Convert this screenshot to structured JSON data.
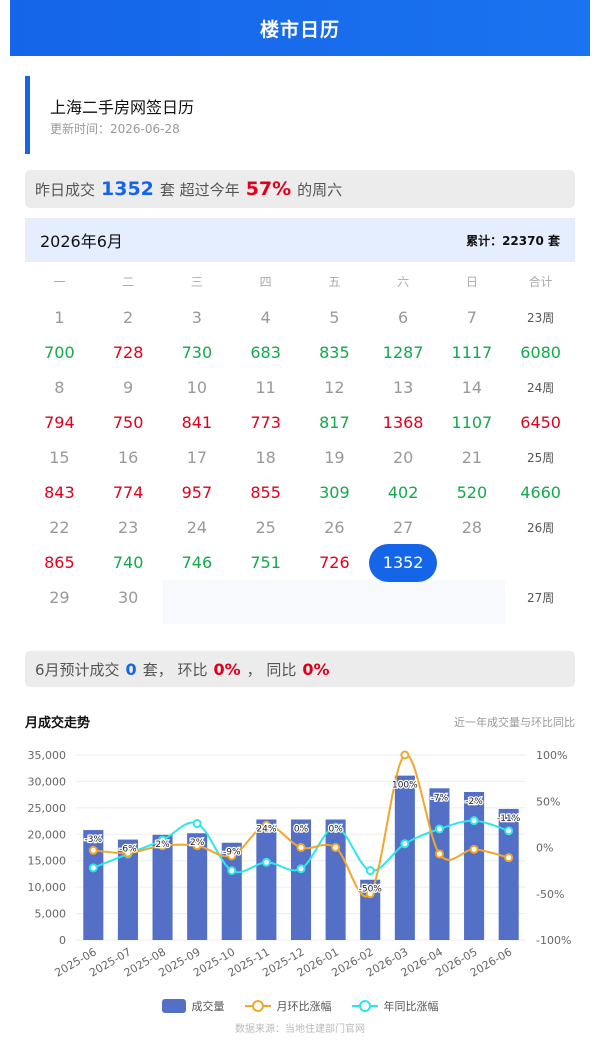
{
  "app": {
    "title": "楼市日历"
  },
  "header": {
    "title": "上海二手房网签日历",
    "updated": "更新时间：2026-06-28"
  },
  "banner": {
    "prefix": "昨日成交",
    "count": "1352",
    "unit": "套 超过今年",
    "pct": "57%",
    "suffix": "的周六"
  },
  "calendar": {
    "month": "2026年6月",
    "total": "累计：22370 套",
    "weekdays": [
      "一",
      "二",
      "三",
      "四",
      "五",
      "六",
      "日",
      "合计"
    ],
    "weeks": [
      {
        "days": [
          "1",
          "2",
          "3",
          "4",
          "5",
          "6",
          "7"
        ],
        "label": "23周",
        "values": [
          [
            "700",
            "down"
          ],
          [
            "728",
            "up"
          ],
          [
            "730",
            "down"
          ],
          [
            "683",
            "down"
          ],
          [
            "835",
            "down"
          ],
          [
            "1287",
            "down"
          ],
          [
            "1117",
            "down"
          ]
        ],
        "sum": [
          "6080",
          "down"
        ]
      },
      {
        "days": [
          "8",
          "9",
          "10",
          "11",
          "12",
          "13",
          "14"
        ],
        "label": "24周",
        "values": [
          [
            "794",
            "up"
          ],
          [
            "750",
            "up"
          ],
          [
            "841",
            "up"
          ],
          [
            "773",
            "up"
          ],
          [
            "817",
            "down"
          ],
          [
            "1368",
            "up"
          ],
          [
            "1107",
            "down"
          ]
        ],
        "sum": [
          "6450",
          "up"
        ]
      },
      {
        "days": [
          "15",
          "16",
          "17",
          "18",
          "19",
          "20",
          "21"
        ],
        "label": "25周",
        "values": [
          [
            "843",
            "up"
          ],
          [
            "774",
            "up"
          ],
          [
            "957",
            "up"
          ],
          [
            "855",
            "up"
          ],
          [
            "309",
            "down"
          ],
          [
            "402",
            "down"
          ],
          [
            "520",
            "down"
          ]
        ],
        "sum": [
          "4660",
          "down"
        ]
      },
      {
        "days": [
          "22",
          "23",
          "24",
          "25",
          "26",
          "27",
          "28"
        ],
        "label": "26周",
        "values": [
          [
            "865",
            "up"
          ],
          [
            "740",
            "down"
          ],
          [
            "746",
            "down"
          ],
          [
            "751",
            "down"
          ],
          [
            "726",
            "up"
          ],
          [
            "1352",
            "today"
          ],
          [
            "",
            ""
          ]
        ],
        "sum": [
          "",
          ""
        ]
      },
      {
        "days": [
          "29",
          "30",
          "",
          "",
          "",
          "",
          ""
        ],
        "label": "27周",
        "values": null,
        "sum": null
      }
    ]
  },
  "predict": {
    "prefix": "6月预计成交",
    "count": "0",
    "mid": "套， 环比",
    "mom": "0%",
    "sep": "，  同比",
    "yoy": "0%"
  },
  "trend": {
    "title": "月成交走势",
    "subtitle": "近一年成交量与环比同比"
  },
  "chart_data": {
    "type": "bar",
    "categories": [
      "2025-06",
      "2025-07",
      "2025-08",
      "2025-09",
      "2025-10",
      "2025-11",
      "2025-12",
      "2026-01",
      "2026-02",
      "2026-03",
      "2026-04",
      "2026-05",
      "2026-06"
    ],
    "series": [
      {
        "name": "成交量",
        "type": "bar",
        "values": [
          20800,
          19000,
          19900,
          20200,
          18400,
          22800,
          22800,
          22800,
          11400,
          31100,
          28700,
          28000,
          24800
        ]
      },
      {
        "name": "月环比涨幅",
        "type": "line",
        "values": [
          -3,
          -6,
          2,
          2,
          -9,
          24,
          0,
          0,
          -50,
          100,
          -7,
          -2,
          -11
        ],
        "labels": [
          "-3%",
          "-6%",
          "2%",
          "2%",
          "-9%",
          "24%",
          "0%",
          "0%",
          "-50%",
          "100%",
          "-7%",
          "-2%",
          "-11%"
        ]
      },
      {
        "name": "年同比涨幅",
        "type": "line",
        "values": [
          -22,
          -7,
          8,
          26,
          -25,
          -16,
          -23,
          22,
          -25,
          4,
          20,
          29,
          18
        ]
      }
    ],
    "y_left": {
      "ticks": [
        "0",
        "5,000",
        "10,000",
        "15,000",
        "20,000",
        "25,000",
        "30,000",
        "35,000"
      ],
      "min": 0,
      "max": 35000
    },
    "y_right": {
      "ticks": [
        "-100%",
        "-50%",
        "0%",
        "50%",
        "100%"
      ],
      "min": -100,
      "max": 100
    },
    "colors": {
      "bar": "#5470c6",
      "mom": "#f2a72a",
      "yoy": "#2ce6ee"
    }
  },
  "legend": [
    "成交量",
    "月环比涨幅",
    "年同比涨幅"
  ],
  "source": "数据来源：当地住建部门官网"
}
